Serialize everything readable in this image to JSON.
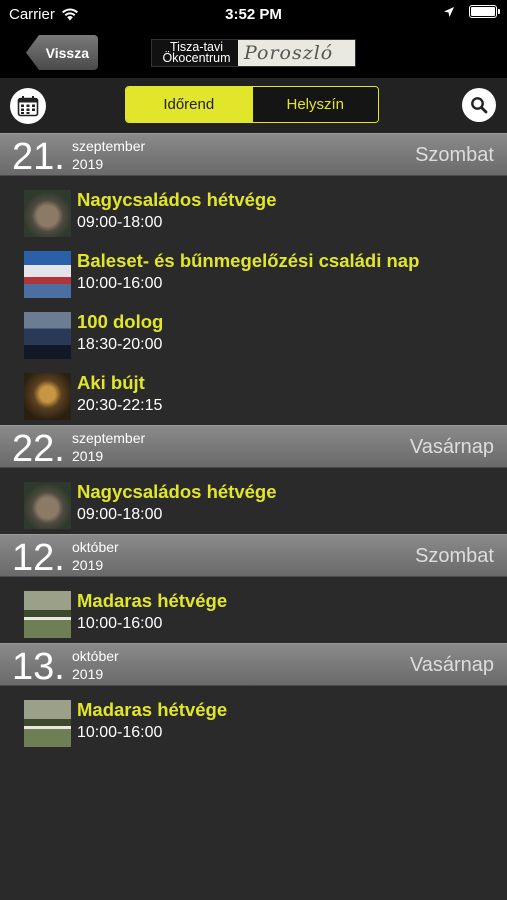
{
  "status_bar": {
    "carrier": "Carrier",
    "time": "3:52 PM",
    "battery_level": 1.0
  },
  "nav": {
    "back_label": "Vissza",
    "logo_left": "Tisza-tavi Ökocentrum",
    "logo_right": "Poroszló"
  },
  "toolbar": {
    "segments": [
      {
        "label": "Időrend",
        "active": true
      },
      {
        "label": "Helyszín",
        "active": false
      }
    ]
  },
  "days": [
    {
      "day": "21.",
      "month": "szeptember",
      "year": "2019",
      "weekday": "Szombat",
      "events": [
        {
          "title": "Nagycsaládos hétvége",
          "time": "09:00-18:00",
          "thumb": "turtle"
        },
        {
          "title": "Baleset- és bűnmegelőzési családi nap",
          "time": "10:00-16:00",
          "thumb": "police"
        },
        {
          "title": "100 dolog",
          "time": "18:30-20:00",
          "thumb": "hundred"
        },
        {
          "title": "Aki bújt",
          "time": "20:30-22:15",
          "thumb": "aki"
        }
      ]
    },
    {
      "day": "22.",
      "month": "szeptember",
      "year": "2019",
      "weekday": "Vasárnap",
      "events": [
        {
          "title": "Nagycsaládos hétvége",
          "time": "09:00-18:00",
          "thumb": "turtle"
        }
      ]
    },
    {
      "day": "12.",
      "month": "október",
      "year": "2019",
      "weekday": "Szombat",
      "events": [
        {
          "title": "Madaras hétvége",
          "time": "10:00-16:00",
          "thumb": "bird"
        }
      ]
    },
    {
      "day": "13.",
      "month": "október",
      "year": "2019",
      "weekday": "Vasárnap",
      "events": [
        {
          "title": "Madaras hétvége",
          "time": "10:00-16:00",
          "thumb": "bird"
        }
      ]
    }
  ],
  "colors": {
    "accent": "#e2e62a",
    "background": "#2a2a2a",
    "header_bar": "#777777"
  }
}
